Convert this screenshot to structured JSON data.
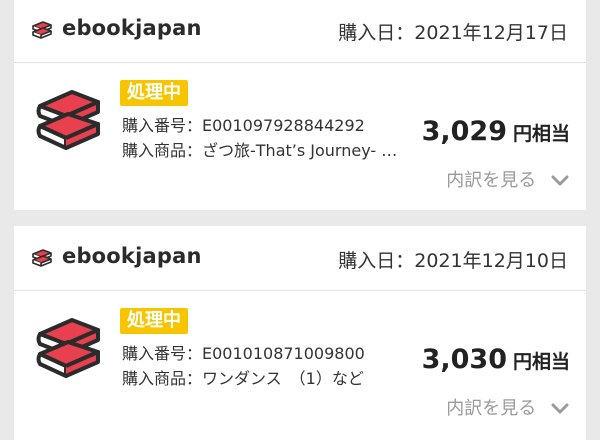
{
  "orders": [
    {
      "brand": "ebookjapan",
      "purchase_date": "購入日：2021年12月17日",
      "status": "処理中",
      "order_number": "購入番号：E001097928844292",
      "item": "購入商品：ざつ旅-That’s Journey- …",
      "price": "3,029",
      "price_suffix": "円相当",
      "details_link": "内訳を見る"
    },
    {
      "brand": "ebookjapan",
      "purchase_date": "購入日：2021年12月10日",
      "status": "処理中",
      "order_number": "購入番号：E001010871009800",
      "item": "購入商品：ワンダンス　（1）など",
      "price": "3,030",
      "price_suffix": "円相当",
      "details_link": "内訳を見る"
    }
  ],
  "colors": {
    "brand_red": "#e8404e",
    "status_yellow": "#f6c500",
    "link_gray": "#9a9a9a",
    "background": "#e9e9e9"
  },
  "icons": {
    "brand": "ebookjapan-books-icon",
    "expand": "chevron-down-icon"
  }
}
